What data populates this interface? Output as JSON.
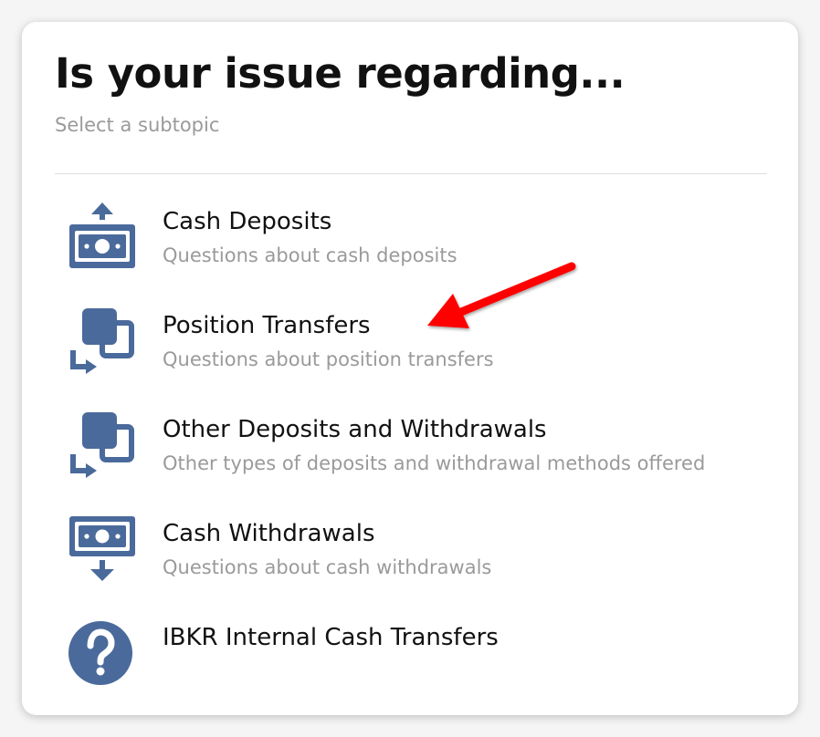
{
  "header": {
    "title": "Is your issue regarding...",
    "subtitle": "Select a subtopic"
  },
  "subtopics": [
    {
      "label": "Cash Deposits",
      "description": "Questions about cash deposits",
      "icon": "cash-deposit-icon"
    },
    {
      "label": "Position Transfers",
      "description": "Questions about position transfers",
      "icon": "position-transfer-icon"
    },
    {
      "label": "Other Deposits and Withdrawals",
      "description": "Other types of deposits and withdrawal methods offered",
      "icon": "position-transfer-icon"
    },
    {
      "label": "Cash Withdrawals",
      "description": "Questions about cash withdrawals",
      "icon": "cash-withdrawal-icon"
    },
    {
      "label": "IBKR Internal Cash Transfers",
      "description": "",
      "icon": "question-circle-icon"
    }
  ],
  "colors": {
    "icon": "#4a6a9b",
    "annotation_arrow": "#ff0000",
    "title": "#111111",
    "muted": "#9a9a9a"
  }
}
